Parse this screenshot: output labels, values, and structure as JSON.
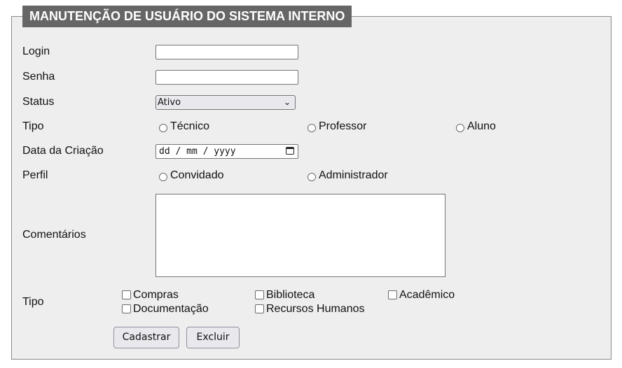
{
  "form": {
    "title": "MANUTENÇÃO DE USUÁRIO DO SISTEMA INTERNO",
    "login": {
      "label": "Login",
      "value": ""
    },
    "senha": {
      "label": "Senha",
      "value": ""
    },
    "status": {
      "label": "Status",
      "selected": "Ativo"
    },
    "tipo": {
      "label": "Tipo",
      "options": [
        "Técnico",
        "Professor",
        "Aluno"
      ]
    },
    "data_criacao": {
      "label": "Data da Criação",
      "placeholder": "dd / mm / yyyy"
    },
    "perfil": {
      "label": "Perfil",
      "options": [
        "Convidado",
        "Administrador"
      ]
    },
    "comentarios": {
      "label": "Comentários",
      "value": ""
    },
    "tipo_areas": {
      "label": "Tipo",
      "options": [
        "Compras",
        "Biblioteca",
        "Acadêmico",
        "Documentação",
        "Recursos Humanos"
      ]
    },
    "buttons": {
      "cadastrar": "Cadastrar",
      "excluir": "Excluir"
    }
  }
}
